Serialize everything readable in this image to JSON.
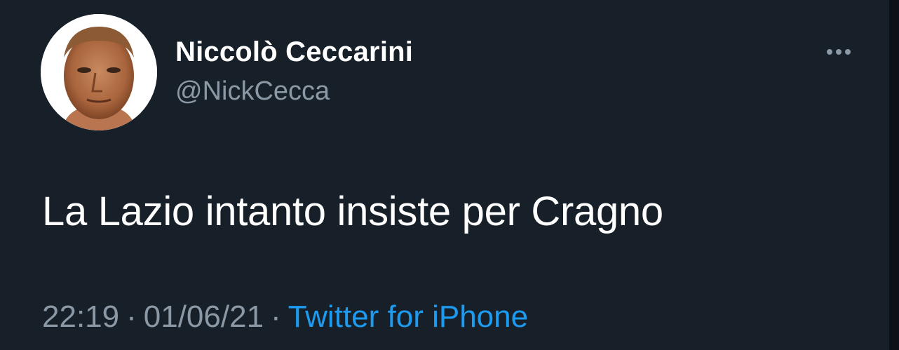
{
  "colors": {
    "background": "#172029",
    "text_primary": "#ffffff",
    "text_secondary": "#8b98a5",
    "link": "#1d9bf0"
  },
  "tweet": {
    "author": {
      "display_name": "Niccolò Ceccarini",
      "handle": "@NickCecca",
      "avatar_icon": "profile-photo"
    },
    "more_icon": "more-options-icon",
    "text": "La Lazio intanto insiste per Cragno",
    "meta": {
      "time": "22:19",
      "separator": "·",
      "date": "01/06/21",
      "source": "Twitter for iPhone"
    }
  }
}
